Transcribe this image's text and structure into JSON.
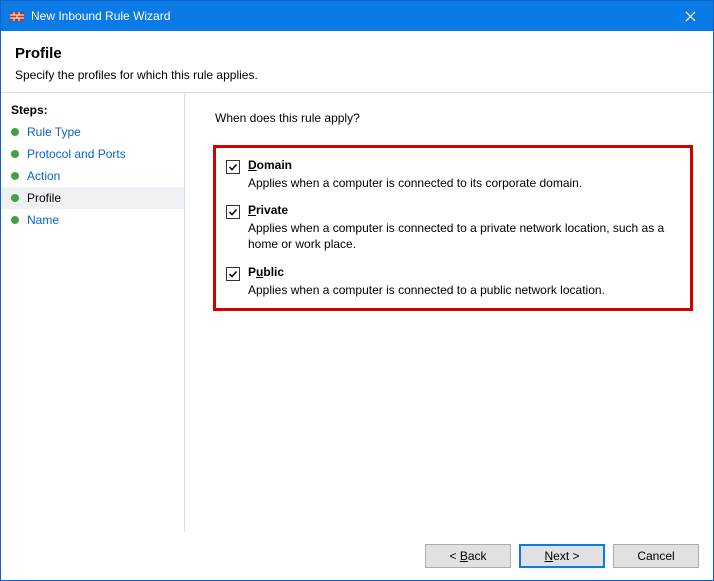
{
  "window": {
    "title": "New Inbound Rule Wizard"
  },
  "header": {
    "title": "Profile",
    "description": "Specify the profiles for which this rule applies."
  },
  "sidebar": {
    "heading": "Steps:",
    "items": [
      {
        "label": "Rule Type"
      },
      {
        "label": "Protocol and Ports"
      },
      {
        "label": "Action"
      },
      {
        "label": "Profile"
      },
      {
        "label": "Name"
      }
    ]
  },
  "main": {
    "question": "When does this rule apply?",
    "options": [
      {
        "label_accel": "D",
        "label_rest": "omain",
        "checked": true,
        "description": "Applies when a computer is connected to its corporate domain."
      },
      {
        "label_accel": "P",
        "label_rest": "rivate",
        "checked": true,
        "description": "Applies when a computer is connected to a private network location, such as a home or work place."
      },
      {
        "label_accel": "u",
        "label_pre": "P",
        "label_rest": "blic",
        "checked": true,
        "description": "Applies when a computer is connected to a public network location."
      }
    ]
  },
  "footer": {
    "back_pre": "< ",
    "back_accel": "B",
    "back_rest": "ack",
    "next_accel": "N",
    "next_rest": "ext >",
    "cancel": "Cancel"
  }
}
